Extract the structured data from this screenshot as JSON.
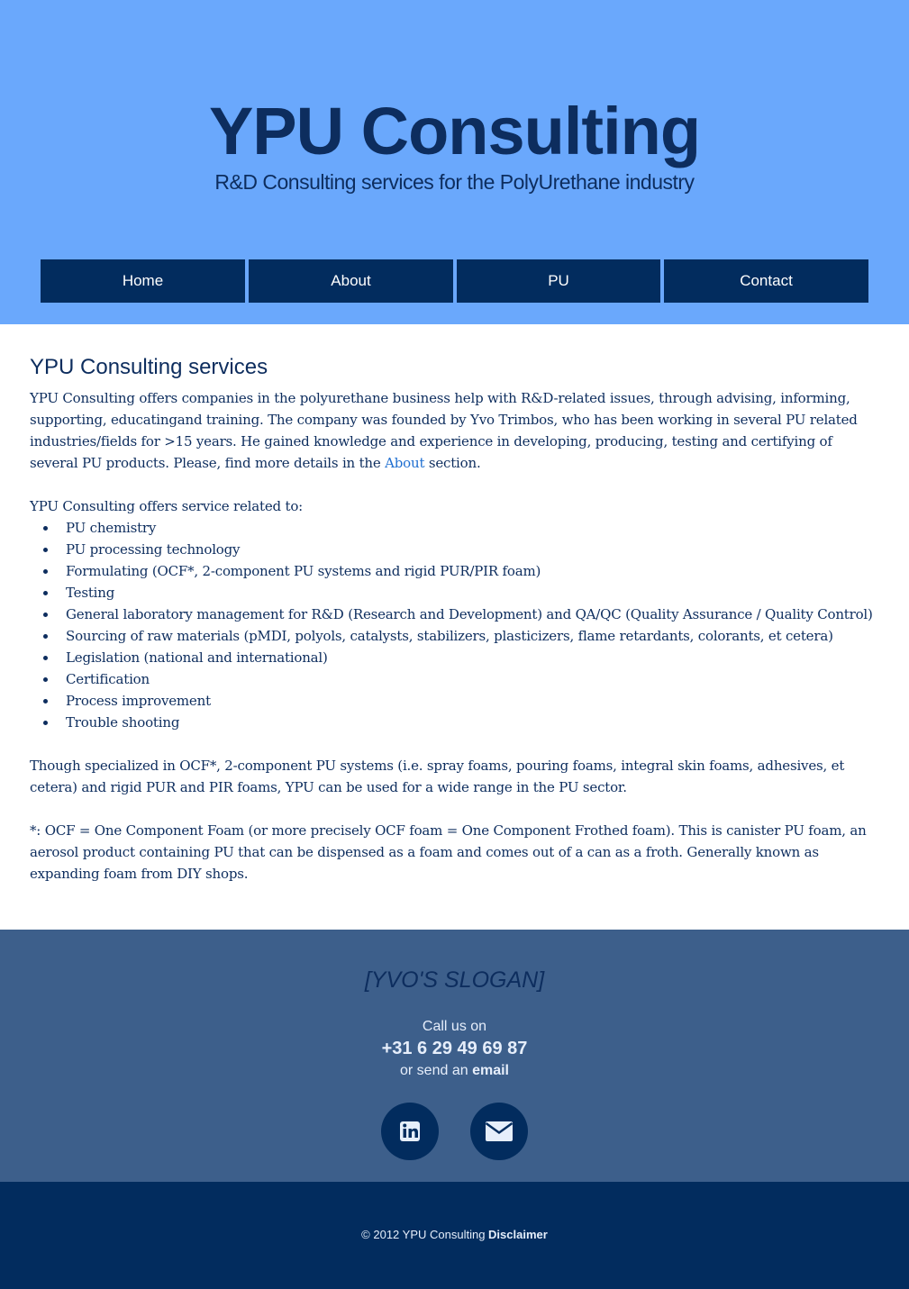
{
  "header": {
    "title": "YPU Consulting",
    "tagline": "R&D Consulting services for the PolyUrethane industry"
  },
  "nav": {
    "items": [
      {
        "label": "Home"
      },
      {
        "label": "About"
      },
      {
        "label": "PU"
      },
      {
        "label": "Contact"
      }
    ]
  },
  "main": {
    "heading": "YPU Consulting services",
    "intro_before_link": "YPU Consulting offers companies in the polyurethane business help with R&D-related issues, through advising, informing, supporting, educatingand training. The company was founded by Yvo Trimbos, who has been working in several PU related industries/fields for >15 years. He gained knowledge and experience in developing, producing, testing and certifying of several PU products. Please, find more details in the ",
    "intro_link": "About",
    "intro_after_link": " section.",
    "services_intro": "YPU Consulting offers service related to:",
    "services": [
      "PU chemistry",
      "PU processing technology",
      "Formulating (OCF*, 2-component PU systems and rigid PUR/PIR foam)",
      "Testing",
      "General laboratory management for R&D (Research and Development) and QA/QC (Quality Assurance / Quality Control)",
      "Sourcing of raw materials (pMDI, polyols, catalysts, stabilizers, plasticizers, flame retardants, colorants, et cetera)",
      "Legislation (national and international)",
      "Certification",
      "Process improvement",
      "Trouble shooting"
    ],
    "specialized": "Though specialized in OCF*, 2-component PU systems (i.e. spray foams, pouring foams, integral skin foams, adhesives, et cetera) and rigid PUR and PIR foams, YPU can be used for a wide range in the PU sector.",
    "footnote": "*: OCF = One Component Foam (or more precisely OCF foam = One Component Frothed foam). This is canister PU foam, an aerosol product containing PU that can be dispensed as a foam and comes out of a can as a froth. Generally known as expanding foam from DIY shops."
  },
  "footer": {
    "slogan": "[YVO'S SLOGAN]",
    "call_label": "Call us on",
    "phone": "+31 6 29 49 69 87",
    "email_prefix": "or send an ",
    "email_link": "email",
    "social": [
      {
        "icon": "linkedin-icon"
      },
      {
        "icon": "envelope-icon"
      }
    ],
    "copyright_text": "© 2012 YPU Consulting ",
    "disclaimer_link": "Disclaimer"
  },
  "colors": {
    "header_bg": "#6aa8fc",
    "nav_bg": "#022c5e",
    "footer_top_bg": "#3d5f8b",
    "footer_bottom_bg": "#022c5e",
    "link": "#1f6fd1",
    "text": "#0d2d5e"
  }
}
